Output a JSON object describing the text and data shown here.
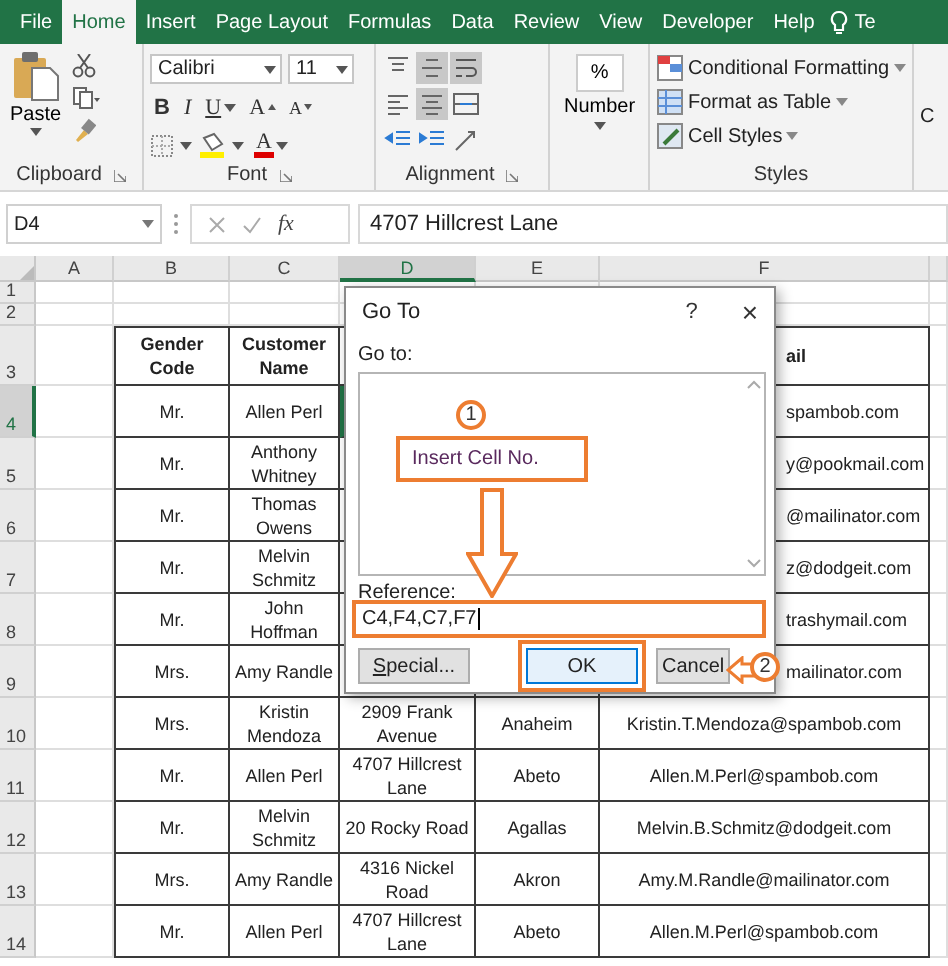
{
  "ribbon_tabs": [
    {
      "label": "File",
      "selected": false
    },
    {
      "label": "Home",
      "selected": true
    },
    {
      "label": "Insert",
      "selected": false
    },
    {
      "label": "Page Layout",
      "selected": false
    },
    {
      "label": "Formulas",
      "selected": false
    },
    {
      "label": "Data",
      "selected": false
    },
    {
      "label": "Review",
      "selected": false
    },
    {
      "label": "View",
      "selected": false
    },
    {
      "label": "Developer",
      "selected": false
    },
    {
      "label": "Help",
      "selected": false
    }
  ],
  "tell_me": "Te",
  "clipboard": {
    "paste": "Paste",
    "label": "Clipboard"
  },
  "font": {
    "name": "Calibri",
    "size": "11",
    "label": "Font",
    "buttons": [
      {
        "kind": "bold",
        "text": "B"
      },
      {
        "kind": "italic",
        "text": "I"
      },
      {
        "kind": "underline",
        "text": "U"
      },
      {
        "kind": "grow",
        "text": "A"
      },
      {
        "kind": "shrink",
        "text": "A"
      }
    ],
    "font_color": "A"
  },
  "alignment": {
    "label": "Alignment",
    "buttons": [
      {
        "kind": "top",
        "selected": false
      },
      {
        "kind": "middle",
        "selected": true
      },
      {
        "kind": "wrap",
        "selected": true
      },
      {
        "kind": "left",
        "selected": false
      },
      {
        "kind": "center",
        "selected": true
      },
      {
        "kind": "merge",
        "selected": false
      },
      {
        "kind": "outdent",
        "selected": false
      },
      {
        "kind": "indent",
        "selected": false
      },
      {
        "kind": "orientation",
        "selected": false
      }
    ]
  },
  "number": {
    "symbol": "%",
    "label": "Number"
  },
  "styles": {
    "items": [
      "Conditional Formatting",
      "Format as Table",
      "Cell Styles"
    ],
    "label": "Styles"
  },
  "cells_group": {
    "label": "C"
  },
  "formula_bar": {
    "name_box": "D4",
    "fx": "fx",
    "value": "4707 Hillcrest Lane"
  },
  "sheet": {
    "columns": [
      {
        "label": "A",
        "selected": false
      },
      {
        "label": "B",
        "selected": false
      },
      {
        "label": "C",
        "selected": false
      },
      {
        "label": "D",
        "selected": true
      },
      {
        "label": "E",
        "selected": false
      },
      {
        "label": "F",
        "selected": false
      }
    ],
    "rows": [
      {
        "label": "1",
        "selected": false
      },
      {
        "label": "2",
        "selected": false
      },
      {
        "label": "3",
        "selected": false,
        "header": true,
        "cells": {
          "B": "Gender Code",
          "C": "Customer Name",
          "F": "ail"
        }
      },
      {
        "label": "4",
        "selected": true,
        "cells": {
          "B": "Mr.",
          "C": "Allen Perl",
          "F": "spambob.com"
        }
      },
      {
        "label": "5",
        "selected": false,
        "cells": {
          "B": "Mr.",
          "C": "Anthony Whitney",
          "F": "y@pookmail.com"
        }
      },
      {
        "label": "6",
        "selected": false,
        "cells": {
          "B": "Mr.",
          "C": "Thomas Owens",
          "F": "@mailinator.com"
        }
      },
      {
        "label": "7",
        "selected": false,
        "cells": {
          "B": "Mr.",
          "C": "Melvin Schmitz",
          "F": "z@dodgeit.com"
        }
      },
      {
        "label": "8",
        "selected": false,
        "cells": {
          "B": "Mr.",
          "C": "John Hoffman",
          "F": "trashymail.com"
        }
      },
      {
        "label": "9",
        "selected": false,
        "cells": {
          "B": "Mrs.",
          "C": "Amy Randle",
          "F": "mailinator.com"
        }
      },
      {
        "label": "10",
        "selected": false,
        "cells": {
          "B": "Mrs.",
          "C": "Kristin Mendoza",
          "D": "2909 Frank Avenue",
          "E": "Anaheim",
          "F": "Kristin.T.Mendoza@spambob.com"
        }
      },
      {
        "label": "11",
        "selected": false,
        "cells": {
          "B": "Mr.",
          "C": "Allen Perl",
          "D": "4707 Hillcrest Lane",
          "E": "Abeto",
          "F": "Allen.M.Perl@spambob.com"
        }
      },
      {
        "label": "12",
        "selected": false,
        "cells": {
          "B": "Mr.",
          "C": "Melvin Schmitz",
          "D": "20 Rocky Road",
          "E": "Agallas",
          "F": "Melvin.B.Schmitz@dodgeit.com"
        }
      },
      {
        "label": "13",
        "selected": false,
        "cells": {
          "B": "Mrs.",
          "C": "Amy Randle",
          "D": "4316 Nickel Road",
          "E": "Akron",
          "F": "Amy.M.Randle@mailinator.com"
        }
      },
      {
        "label": "14",
        "selected": false,
        "cells": {
          "B": "Mr.",
          "C": "Allen Perl",
          "D": "4707 Hillcrest Lane",
          "E": "Abeto",
          "F": "Allen.M.Perl@spambob.com"
        }
      }
    ]
  },
  "dialog": {
    "title": "Go To",
    "help": "?",
    "close": "×",
    "goto_label": "Go to:",
    "reference_label": "Reference:",
    "reference_value": "C4,F4,C7,F7",
    "buttons": [
      {
        "kind": "special",
        "label": "Special..."
      },
      {
        "kind": "default",
        "label": "OK"
      },
      {
        "kind": "cancel",
        "label": "Cancel"
      }
    ],
    "annotations": [
      {
        "kind": "callout",
        "number": "1",
        "text": "Insert Cell No."
      },
      {
        "kind": "pointer",
        "number": "2"
      }
    ]
  }
}
